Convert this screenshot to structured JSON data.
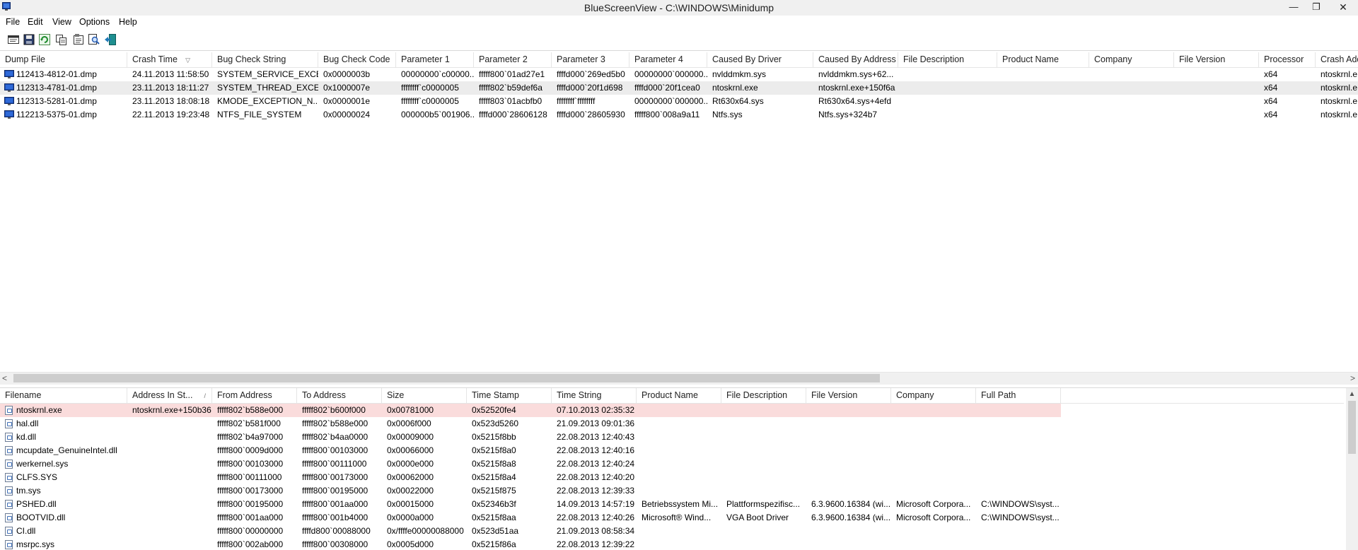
{
  "window": {
    "title": "BlueScreenView  -  C:\\WINDOWS\\Minidump",
    "minimize": "—",
    "restore": "❐",
    "close": "✕"
  },
  "menu": [
    "File",
    "Edit",
    "View",
    "Options",
    "Help"
  ],
  "toolbar": [
    "properties-icon",
    "save-icon",
    "refresh-icon",
    "copy-icon",
    "html-report-icon",
    "find-icon",
    "exit-icon"
  ],
  "upper_list": {
    "columns": [
      "Dump File",
      "Crash Time",
      "Bug Check String",
      "Bug Check Code",
      "Parameter 1",
      "Parameter 2",
      "Parameter 3",
      "Parameter 4",
      "Caused By Driver",
      "Caused By Address",
      "File Description",
      "Product Name",
      "Company",
      "File Version",
      "Processor",
      "Crash Add"
    ],
    "sort_indicator": "▽",
    "rows": [
      [
        "112413-4812-01.dmp",
        "24.11.2013 11:58:50",
        "SYSTEM_SERVICE_EXCE...",
        "0x0000003b",
        "00000000`c00000...",
        "fffff800`01ad27e1",
        "ffffd000`269ed5b0",
        "00000000`000000...",
        "nvlddmkm.sys",
        "nvlddmkm.sys+62...",
        "",
        "",
        "",
        "",
        "x64",
        "ntoskrnl.e"
      ],
      [
        "112313-4781-01.dmp",
        "23.11.2013 18:11:27",
        "SYSTEM_THREAD_EXCE...",
        "0x1000007e",
        "ffffffff`c0000005",
        "fffff802`b59def6a",
        "ffffd000`20f1d698",
        "ffffd000`20f1cea0",
        "ntoskrnl.exe",
        "ntoskrnl.exe+150f6a",
        "",
        "",
        "",
        "",
        "x64",
        "ntoskrnl.e"
      ],
      [
        "112313-5281-01.dmp",
        "23.11.2013 18:08:18",
        "KMODE_EXCEPTION_N...",
        "0x0000001e",
        "ffffffff`c0000005",
        "fffff803`01acbfb0",
        "ffffffff`ffffffff",
        "00000000`000000...",
        "Rt630x64.sys",
        "Rt630x64.sys+4efd",
        "",
        "",
        "",
        "",
        "x64",
        "ntoskrnl.e"
      ],
      [
        "112213-5375-01.dmp",
        "22.11.2013 19:23:48",
        "NTFS_FILE_SYSTEM",
        "0x00000024",
        "000000b5`001906...",
        "ffffd000`28606128",
        "ffffd000`28605930",
        "fffff800`008a9a11",
        "Ntfs.sys",
        "Ntfs.sys+324b7",
        "",
        "",
        "",
        "",
        "x64",
        "ntoskrnl.e"
      ]
    ],
    "selected_row": 1
  },
  "scrollbar": {
    "left_arrow": "<",
    "right_arrow": ">",
    "up_arrow": "▲"
  },
  "lower_list": {
    "columns": [
      "Filename",
      "Address In St...",
      "From Address",
      "To Address",
      "Size",
      "Time Stamp",
      "Time String",
      "Product Name",
      "File Description",
      "File Version",
      "Company",
      "Full Path"
    ],
    "sort_indicator": "/",
    "rows": [
      [
        "ntoskrnl.exe",
        "ntoskrnl.exe+150b36",
        "fffff802`b588e000",
        "fffff802`b600f000",
        "0x00781000",
        "0x52520fe4",
        "07.10.2013 02:35:32",
        "",
        "",
        "",
        "",
        ""
      ],
      [
        "hal.dll",
        "",
        "fffff802`b581f000",
        "fffff802`b588e000",
        "0x0006f000",
        "0x523d5260",
        "21.09.2013 09:01:36",
        "",
        "",
        "",
        "",
        ""
      ],
      [
        "kd.dll",
        "",
        "fffff802`b4a97000",
        "fffff802`b4aa0000",
        "0x00009000",
        "0x5215f8bb",
        "22.08.2013 12:40:43",
        "",
        "",
        "",
        "",
        ""
      ],
      [
        "mcupdate_GenuineIntel.dll",
        "",
        "fffff800`0009d000",
        "fffff800`00103000",
        "0x00066000",
        "0x5215f8a0",
        "22.08.2013 12:40:16",
        "",
        "",
        "",
        "",
        ""
      ],
      [
        "werkernel.sys",
        "",
        "fffff800`00103000",
        "fffff800`00111000",
        "0x0000e000",
        "0x5215f8a8",
        "22.08.2013 12:40:24",
        "",
        "",
        "",
        "",
        ""
      ],
      [
        "CLFS.SYS",
        "",
        "fffff800`00111000",
        "fffff800`00173000",
        "0x00062000",
        "0x5215f8a4",
        "22.08.2013 12:40:20",
        "",
        "",
        "",
        "",
        ""
      ],
      [
        "tm.sys",
        "",
        "fffff800`00173000",
        "fffff800`00195000",
        "0x00022000",
        "0x5215f875",
        "22.08.2013 12:39:33",
        "",
        "",
        "",
        "",
        ""
      ],
      [
        "PSHED.dll",
        "",
        "fffff800`00195000",
        "fffff800`001aa000",
        "0x00015000",
        "0x52346b3f",
        "14.09.2013 14:57:19",
        "Betriebssystem Mi...",
        "Plattformspezifisc...",
        "6.3.9600.16384 (wi...",
        "Microsoft Corpora...",
        "C:\\WINDOWS\\syst..."
      ],
      [
        "BOOTVID.dll",
        "",
        "fffff800`001aa000",
        "fffff800`001b4000",
        "0x0000a000",
        "0x5215f8aa",
        "22.08.2013 12:40:26",
        "Microsoft® Wind...",
        "VGA Boot Driver",
        "6.3.9600.16384 (wi...",
        "Microsoft Corpora...",
        "C:\\WINDOWS\\syst..."
      ],
      [
        "CI.dll",
        "",
        "fffff800`00000000",
        "ffffd800`00088000",
        "0x/ffffe00000088000",
        "0x523d51aa",
        "21.09.2013 08:58:34",
        "",
        "",
        "",
        "",
        ""
      ],
      [
        "msrpc.sys",
        "",
        "fffff800`002ab000",
        "fffff800`00308000",
        "0x0005d000",
        "0x5215f86a",
        "22.08.2013 12:39:22",
        "",
        "",
        "",
        "",
        ""
      ]
    ],
    "highlighted_row": 0
  }
}
